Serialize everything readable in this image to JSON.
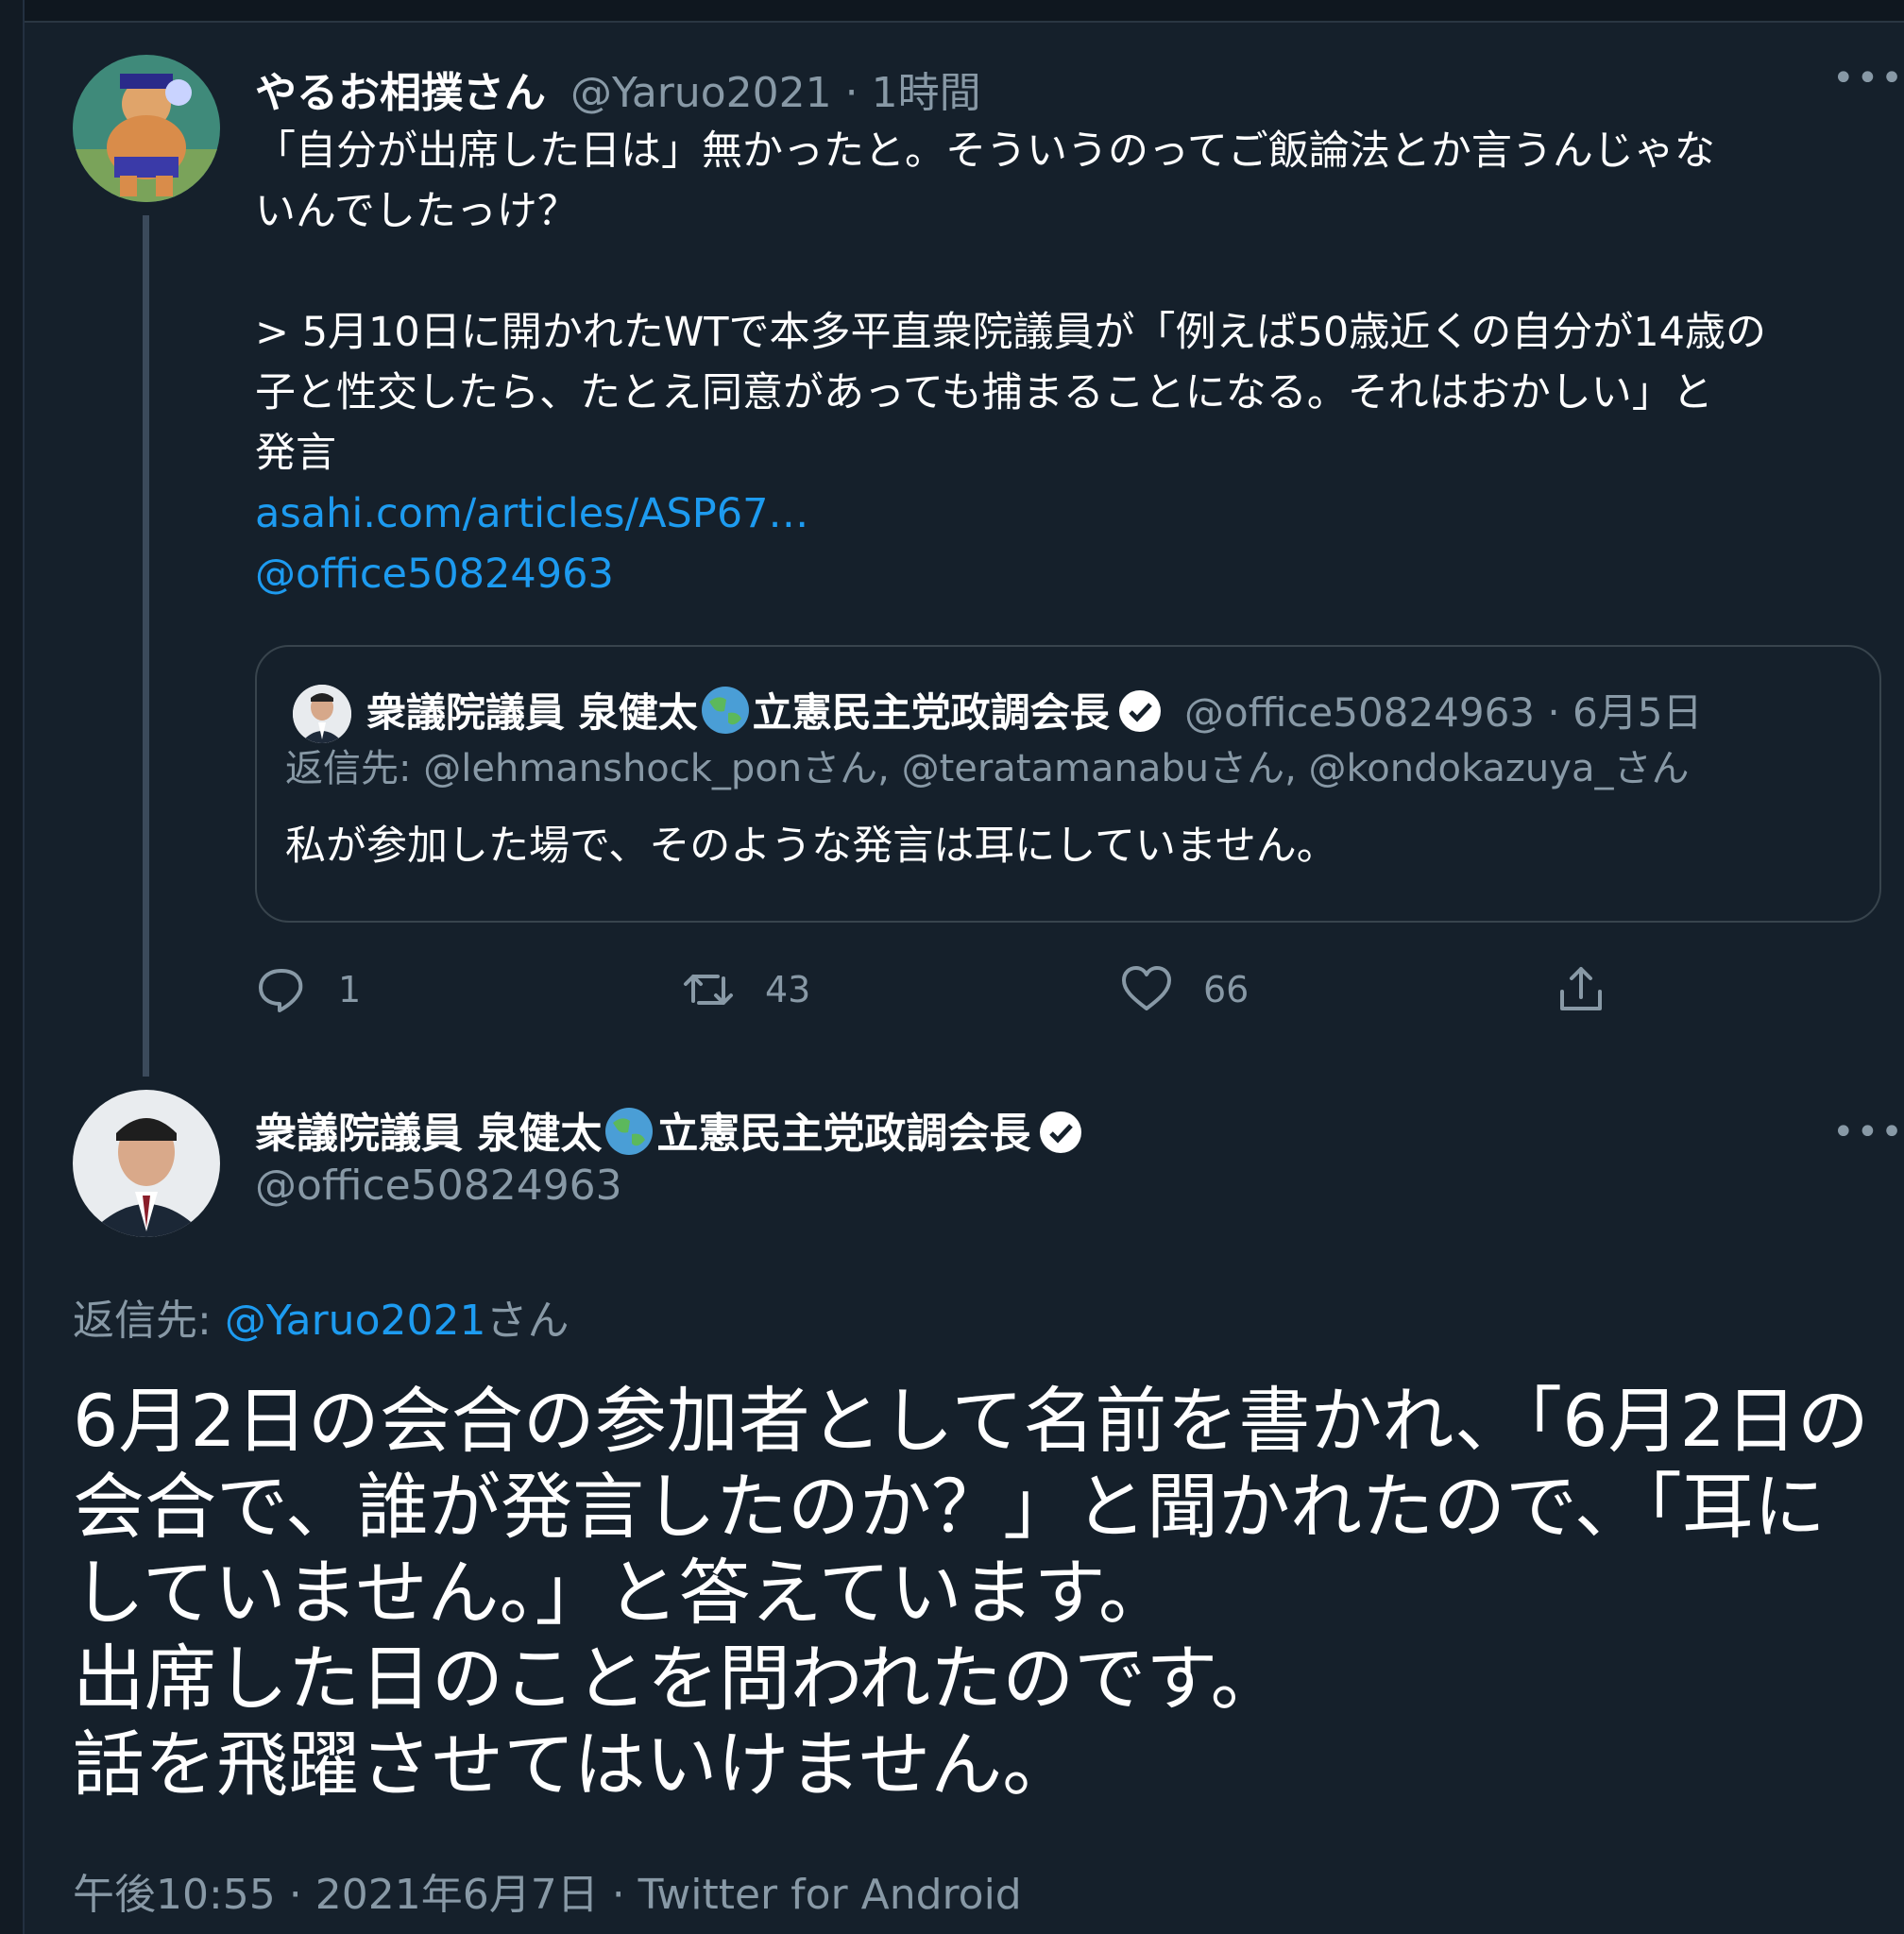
{
  "tweet1": {
    "name": "やるお相撲さん",
    "handle": "@Yaruo2021",
    "time": "1時間",
    "text_line1": "「自分が出席した日は」無かったと。そういうのってご飯論法とか言うんじゃな",
    "text_line2": "いんでしたっけ？",
    "quote_line1": "> 5月10日に開かれたWTで本多平直衆院議員が「例えば50歳近くの自分が14歳の",
    "quote_line2": "子と性交したら、たとえ同意があっても捕まることになる。それはおかしい」と",
    "quote_line3": "発言",
    "link": "asahi.com/articles/ASP67…",
    "mention": "@office50824963"
  },
  "quoted": {
    "name_a": "衆議院議員 泉健太",
    "name_b": "立憲民主党政調会長",
    "handle_date": "@office50824963 · 6月5日",
    "reply_label": "返信先: ",
    "reply_to": "@lehmanshock_ponさん, @teratamanabuさん, @kondokazuya_さん",
    "text": "私が参加した場で、そのような発言は耳にしていません。"
  },
  "actions": {
    "reply_count": "1",
    "retweet_count": "43",
    "like_count": "66"
  },
  "tweet2": {
    "name_a": "衆議院議員 泉健太",
    "name_b": "立憲民主党政調会長",
    "handle": "@office50824963",
    "reply_label": "返信先: ",
    "reply_to": "@Yaruo2021",
    "reply_suffix": "さん",
    "line1": "6月2日の会合の参加者として名前を書かれ、「6月2日の",
    "line2": "会合で、誰が発言したのか？」と聞かれたので、「耳に",
    "line3": "していません。」と答えています。",
    "line4": "出席した日のことを問われたのです。",
    "line5": "話を飛躍させてはいけません。",
    "footer": "午後10:55 · 2021年6月7日 · Twitter for Android"
  },
  "colors": {
    "background": "#15202b",
    "link": "#1d9bf0",
    "secondary": "#8899a6",
    "border": "#38444d"
  }
}
